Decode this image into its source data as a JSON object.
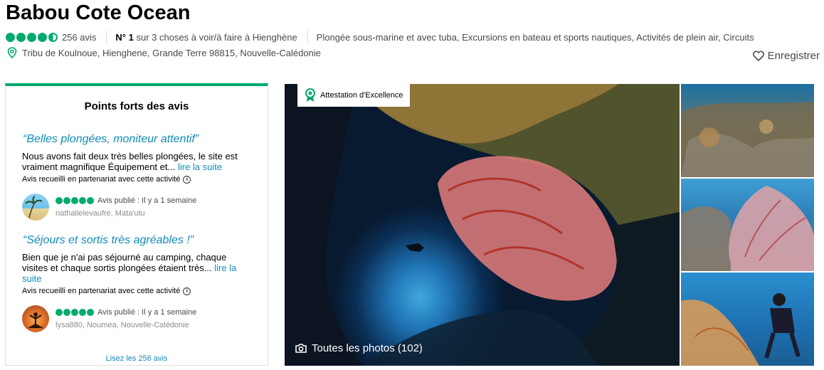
{
  "header": {
    "title": "Babou Cote Ocean",
    "review_count": "256 avis",
    "rank_prefix": "N° 1",
    "rank_text": "sur 3 choses à voir/à faire à Hienghène",
    "categories": "Plongée sous-marine et avec tuba, Excursions en bateau et sports nautiques, Activités de plein air, Circuits",
    "address": "Tribu de Koulnoue, Hienghene, Grande Terre 98815, Nouvelle-Calédonie",
    "save_label": "Enregistrer",
    "rating_bubbles": 4.5
  },
  "highlights": {
    "title": "Points forts des avis",
    "reviews": [
      {
        "title": "“Belles plongées, moniteur attentif”",
        "body": "Nous avons fait deux très belles plongées, le site est vraiment magnifique Équipement et...",
        "more": "lire la suite",
        "partner": "Avis recueilli en partenariat avec cette activité",
        "published": "Avis publié : Il y a 1 semaine",
        "user": "nathalielevaufre",
        "location": ", Mata'utu",
        "rating": 5
      },
      {
        "title": "“Séjours et sortis très agréables !”",
        "body": "Bien que je n'ai pas séjourné au camping, chaque visites et chaque sortis plongées étaient très...",
        "more": "lire la suite",
        "partner": "Avis recueilli en partenariat avec cette activité",
        "published": "Avis publié : Il y a 1 semaine",
        "user": "lysa880",
        "location": ", Noumea, Nouvelle-Calédonie",
        "rating": 5
      }
    ],
    "read_all": "Lisez les 256 avis"
  },
  "photos": {
    "badge": "Attestation d'Excellence",
    "all_photos": "Toutes les photos (102)"
  },
  "colors": {
    "accent": "#00aa6c",
    "link": "#118bbb"
  }
}
